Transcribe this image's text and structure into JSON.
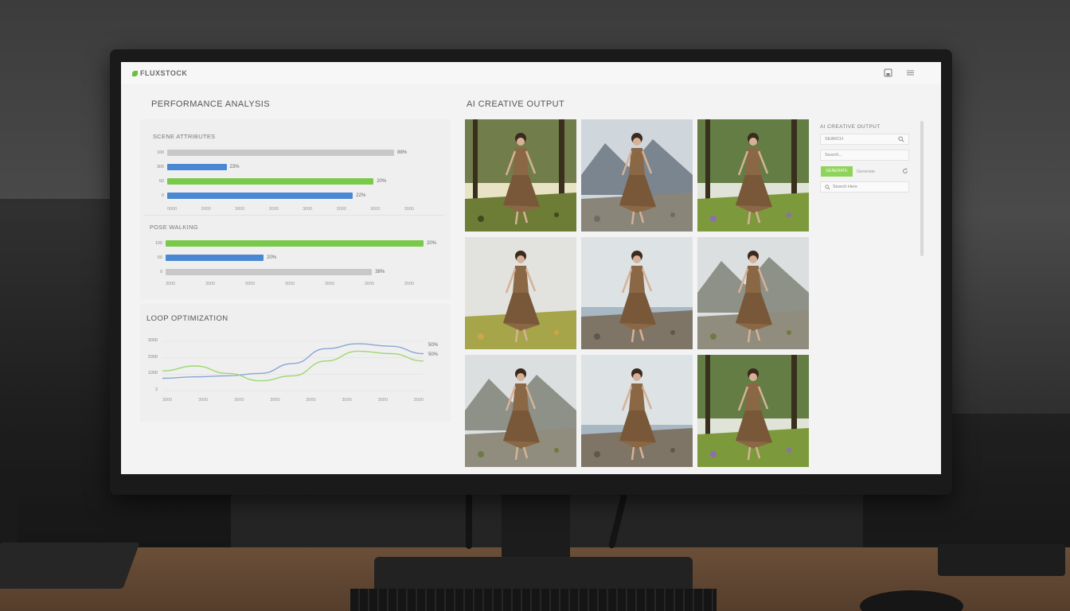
{
  "app": {
    "brand": "FLUXSTOCK"
  },
  "left": {
    "title": "PERFORMANCE ANALYSIS",
    "chart1": {
      "label": "SCENE ATTRIBUTES",
      "rows": [
        {
          "y": "100",
          "value": 0.88,
          "color": "gray",
          "pct": "88%"
        },
        {
          "y": "300",
          "value": 0.23,
          "color": "blue",
          "pct": "23%"
        },
        {
          "y": "50",
          "value": 0.8,
          "color": "green",
          "pct": "20%"
        },
        {
          "y": "0",
          "value": 0.72,
          "color": "blue",
          "pct": "22%"
        }
      ],
      "xticks": [
        "0000",
        "3000",
        "3000",
        "3000",
        "3000",
        "3000",
        "3000",
        "3000"
      ]
    },
    "chart2": {
      "label": "POSE WALKING",
      "rows": [
        {
          "y": "100",
          "value": 1.0,
          "color": "green",
          "pct": "20%"
        },
        {
          "y": "50",
          "value": 0.38,
          "color": "blue",
          "pct": "20%"
        },
        {
          "y": "0",
          "value": 0.8,
          "color": "gray",
          "pct": "38%"
        }
      ],
      "xticks": [
        "3000",
        "3000",
        "3000",
        "3000",
        "3000",
        "3000",
        "3000"
      ]
    },
    "loop": {
      "title": "LOOP OPTIMIZATION",
      "yticks": [
        "3000",
        "2000",
        "1000",
        "2"
      ],
      "xticks": [
        "3000",
        "3000",
        "3000",
        "3000",
        "3000",
        "3000",
        "3000",
        "3000"
      ],
      "end_labels": [
        "50%",
        "50%"
      ],
      "series": [
        {
          "color": "#8aa6d6",
          "values": [
            0.25,
            0.28,
            0.3,
            0.35,
            0.55,
            0.85,
            0.95,
            0.9,
            0.75
          ]
        },
        {
          "color": "#9ed870",
          "values": [
            0.4,
            0.5,
            0.35,
            0.2,
            0.3,
            0.6,
            0.8,
            0.75,
            0.6
          ]
        }
      ]
    }
  },
  "right": {
    "title": "AI CREATIVE OUTPUT",
    "photos": [
      {
        "scene": "forest"
      },
      {
        "scene": "mountain"
      },
      {
        "scene": "meadow"
      },
      {
        "scene": "field"
      },
      {
        "scene": "sea"
      },
      {
        "scene": "hills"
      },
      {
        "scene": "hills"
      },
      {
        "scene": "sea"
      },
      {
        "scene": "meadow"
      }
    ]
  },
  "sidebar": {
    "title": "AI CREATIVE OUTPUT",
    "search_value": "SEARCH",
    "field2": "Search...",
    "button_label": "GENERATE",
    "button_side": "Generate",
    "search2": "Search Here"
  }
}
